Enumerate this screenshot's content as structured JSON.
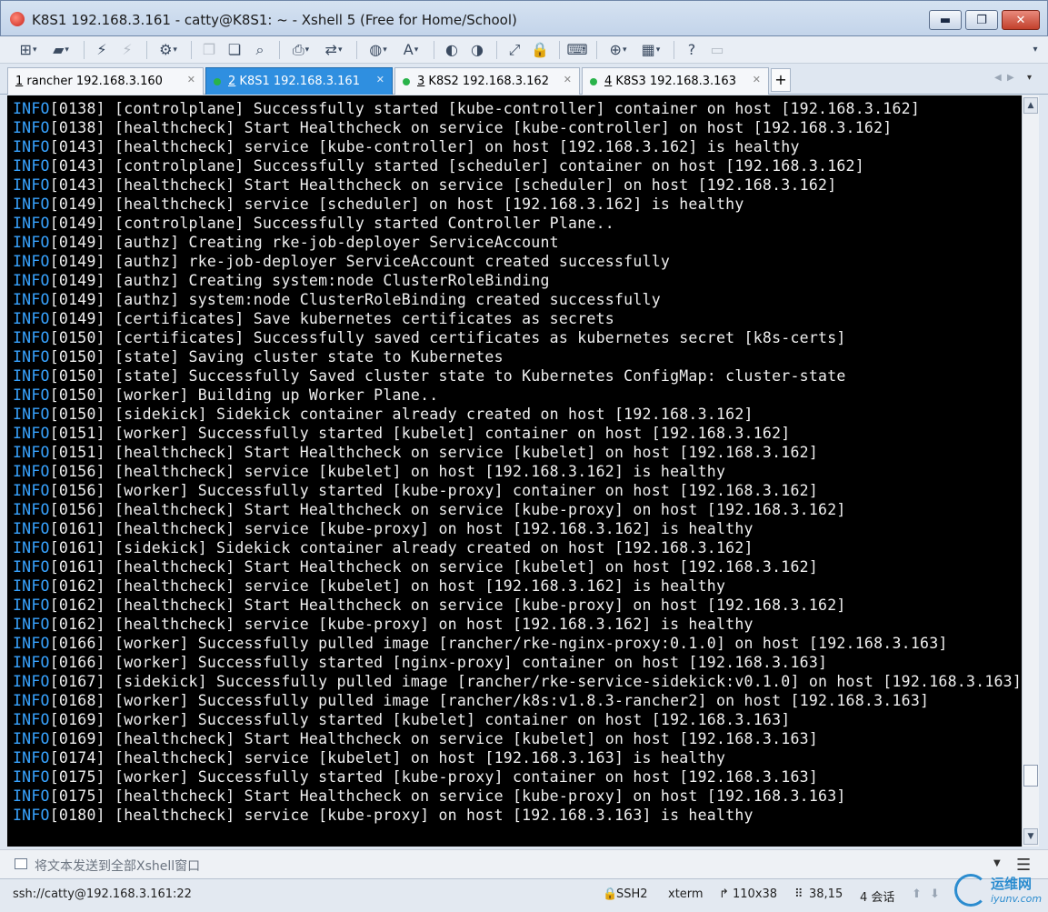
{
  "window": {
    "title": "K8S1 192.168.3.161 - catty@K8S1: ~ - Xshell 5 (Free for Home/School)",
    "minimize_label": "▬",
    "maximize_label": "❐",
    "close_label": "✕"
  },
  "tabs": [
    {
      "num": "1",
      "label": " rancher 192.168.3.160",
      "active": false,
      "dot": false
    },
    {
      "num": "2",
      "label": " K8S1 192.168.3.161",
      "active": true,
      "dot": true
    },
    {
      "num": "3",
      "label": " K8S2 192.168.3.162",
      "active": false,
      "dot": true
    },
    {
      "num": "4",
      "label": " K8S3 192.168.3.163",
      "active": false,
      "dot": true
    }
  ],
  "terminal": {
    "lines": [
      [
        "INFO",
        "[0138] [controlplane] Successfully started [kube-controller] container on host [192.168.3.162]"
      ],
      [
        "INFO",
        "[0138] [healthcheck] Start Healthcheck on service [kube-controller] on host [192.168.3.162]"
      ],
      [
        "INFO",
        "[0143] [healthcheck] service [kube-controller] on host [192.168.3.162] is healthy"
      ],
      [
        "INFO",
        "[0143] [controlplane] Successfully started [scheduler] container on host [192.168.3.162]"
      ],
      [
        "INFO",
        "[0143] [healthcheck] Start Healthcheck on service [scheduler] on host [192.168.3.162]"
      ],
      [
        "INFO",
        "[0149] [healthcheck] service [scheduler] on host [192.168.3.162] is healthy"
      ],
      [
        "INFO",
        "[0149] [controlplane] Successfully started Controller Plane.."
      ],
      [
        "INFO",
        "[0149] [authz] Creating rke-job-deployer ServiceAccount"
      ],
      [
        "INFO",
        "[0149] [authz] rke-job-deployer ServiceAccount created successfully"
      ],
      [
        "INFO",
        "[0149] [authz] Creating system:node ClusterRoleBinding"
      ],
      [
        "INFO",
        "[0149] [authz] system:node ClusterRoleBinding created successfully"
      ],
      [
        "INFO",
        "[0149] [certificates] Save kubernetes certificates as secrets"
      ],
      [
        "INFO",
        "[0150] [certificates] Successfully saved certificates as kubernetes secret [k8s-certs]"
      ],
      [
        "INFO",
        "[0150] [state] Saving cluster state to Kubernetes"
      ],
      [
        "INFO",
        "[0150] [state] Successfully Saved cluster state to Kubernetes ConfigMap: cluster-state"
      ],
      [
        "INFO",
        "[0150] [worker] Building up Worker Plane.."
      ],
      [
        "INFO",
        "[0150] [sidekick] Sidekick container already created on host [192.168.3.162]"
      ],
      [
        "INFO",
        "[0151] [worker] Successfully started [kubelet] container on host [192.168.3.162]"
      ],
      [
        "INFO",
        "[0151] [healthcheck] Start Healthcheck on service [kubelet] on host [192.168.3.162]"
      ],
      [
        "INFO",
        "[0156] [healthcheck] service [kubelet] on host [192.168.3.162] is healthy"
      ],
      [
        "INFO",
        "[0156] [worker] Successfully started [kube-proxy] container on host [192.168.3.162]"
      ],
      [
        "INFO",
        "[0156] [healthcheck] Start Healthcheck on service [kube-proxy] on host [192.168.3.162]"
      ],
      [
        "INFO",
        "[0161] [healthcheck] service [kube-proxy] on host [192.168.3.162] is healthy"
      ],
      [
        "INFO",
        "[0161] [sidekick] Sidekick container already created on host [192.168.3.162]"
      ],
      [
        "INFO",
        "[0161] [healthcheck] Start Healthcheck on service [kubelet] on host [192.168.3.162]"
      ],
      [
        "INFO",
        "[0162] [healthcheck] service [kubelet] on host [192.168.3.162] is healthy"
      ],
      [
        "INFO",
        "[0162] [healthcheck] Start Healthcheck on service [kube-proxy] on host [192.168.3.162]"
      ],
      [
        "INFO",
        "[0162] [healthcheck] service [kube-proxy] on host [192.168.3.162] is healthy"
      ],
      [
        "INFO",
        "[0166] [worker] Successfully pulled image [rancher/rke-nginx-proxy:0.1.0] on host [192.168.3.163]"
      ],
      [
        "INFO",
        "[0166] [worker] Successfully started [nginx-proxy] container on host [192.168.3.163]"
      ],
      [
        "INFO",
        "[0167] [sidekick] Successfully pulled image [rancher/rke-service-sidekick:v0.1.0] on host [192.168.3.163]"
      ],
      [
        "INFO",
        "[0168] [worker] Successfully pulled image [rancher/k8s:v1.8.3-rancher2] on host [192.168.3.163]"
      ],
      [
        "INFO",
        "[0169] [worker] Successfully started [kubelet] container on host [192.168.3.163]"
      ],
      [
        "INFO",
        "[0169] [healthcheck] Start Healthcheck on service [kubelet] on host [192.168.3.163]"
      ],
      [
        "INFO",
        "[0174] [healthcheck] service [kubelet] on host [192.168.3.163] is healthy"
      ],
      [
        "INFO",
        "[0175] [worker] Successfully started [kube-proxy] container on host [192.168.3.163]"
      ],
      [
        "INFO",
        "[0175] [healthcheck] Start Healthcheck on service [kube-proxy] on host [192.168.3.163]"
      ],
      [
        "INFO",
        "[0180] [healthcheck] service [kube-proxy] on host [192.168.3.163] is healthy"
      ]
    ]
  },
  "compose": {
    "text": "将文本发送到全部Xshell窗口"
  },
  "status": {
    "connection": "ssh://catty@192.168.3.161:22",
    "protocol": "SSH2",
    "terminal_type": "xterm",
    "size": "110x38",
    "cursor": "38,15",
    "sessions": "4 会话"
  },
  "watermark": {
    "text": "运维网",
    "sub": "iyunv.com"
  }
}
